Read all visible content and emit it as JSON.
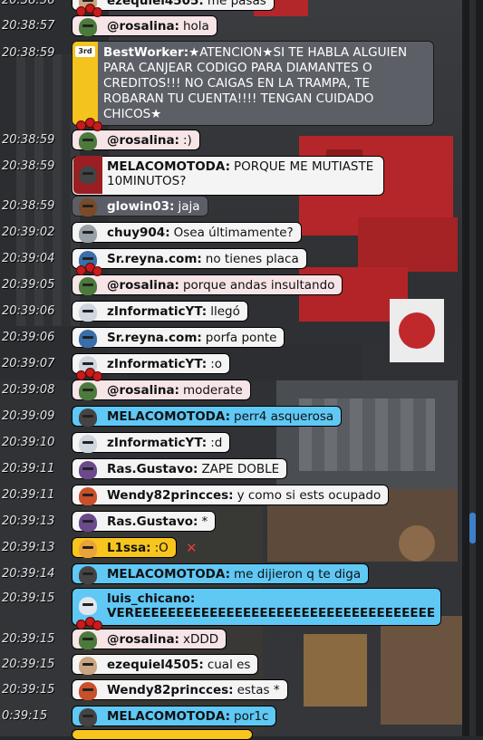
{
  "colors": {
    "bubble_default": "#f4f4f4",
    "bubble_blue": "#5fc8f5",
    "bubble_pink": "#f6e4e6",
    "announce_bg": "#5c5f66",
    "announce_strip": "#f4c31d",
    "scrollbar_thumb": "#3f7fc9"
  },
  "chat": [
    {
      "time": "20:38:56",
      "user": "ezequiel4505:",
      "text": "me pasas",
      "style": "default",
      "avatar": "red-cap-avatar"
    },
    {
      "time": "20:38:57",
      "user": "@rosalina:",
      "text": "hola",
      "style": "pink",
      "avatar": "red-flower-avatar"
    },
    {
      "time": "20:38:59",
      "user": "@rosalina:",
      "text": ":)",
      "style": "pink",
      "avatar": "red-flower-avatar"
    },
    {
      "time": "20:38:59",
      "user": "MELACOMOTODA:",
      "text": "PORQUE ME MUTIASTE",
      "text2": "10MINUTOS?",
      "style": "tall",
      "avatar": "dark-helmet-avatar"
    },
    {
      "time": "20:38:59",
      "user": "glowin03:",
      "text": "jaja",
      "style": "gray",
      "avatar": "brown-hair-avatar"
    },
    {
      "time": "20:39:02",
      "user": "chuy904:",
      "text": "Osea últimamente?",
      "style": "default",
      "avatar": "gray-hat-avatar"
    },
    {
      "time": "20:39:04",
      "user": "Sr.reyna.com:",
      "text": "no tienes placa",
      "style": "default",
      "avatar": "blue-cap-avatar"
    },
    {
      "time": "20:39:05",
      "user": "@rosalina:",
      "text": "porque andas insultando",
      "style": "pink",
      "avatar": "red-flower-avatar"
    },
    {
      "time": "20:39:06",
      "user": "zInformaticYT:",
      "text": "llegó",
      "style": "default",
      "avatar": "white-hair-avatar"
    },
    {
      "time": "20:39:06",
      "user": "Sr.reyna.com:",
      "text": "porfa ponte",
      "style": "default",
      "avatar": "blue-cap-avatar"
    },
    {
      "time": "20:39:07",
      "user": "zInformaticYT:",
      "text": ":o",
      "style": "default",
      "avatar": "white-hair-avatar"
    },
    {
      "time": "20:39:08",
      "user": "@rosalina:",
      "text": "moderate",
      "style": "pink",
      "avatar": "red-flower-avatar"
    },
    {
      "time": "20:39:09",
      "user": "MELACOMOTODA:",
      "text": "perr4 asquerosa",
      "style": "blue",
      "avatar": "dark-helmet-avatar"
    },
    {
      "time": "20:39:10",
      "user": "zInformaticYT:",
      "text": ":d",
      "style": "default",
      "avatar": "white-hair-avatar"
    },
    {
      "time": "20:39:11",
      "user": "Ras.Gustavo:",
      "text": "ZAPE DOBLE",
      "style": "default",
      "avatar": "purple-hat-avatar"
    },
    {
      "time": "20:39:11",
      "user": "Wendy82princces:",
      "text": "y como si ests ocupado",
      "style": "default",
      "avatar": "red-hair-avatar"
    },
    {
      "time": "20:39:13",
      "user": "Ras.Gustavo:",
      "text": "*",
      "style": "default",
      "avatar": "purple-hat-avatar"
    },
    {
      "time": "20:39:13",
      "user": "L1ssa:",
      "text": ":O",
      "style": "default",
      "avatar": "yellow-avatar"
    },
    {
      "time": "20:39:14",
      "user": "MELACOMOTODA:",
      "text": "me dijieron q te diga",
      "style": "blue",
      "avatar": "dark-helmet-avatar"
    },
    {
      "time": "20:39:15",
      "user": "luis_chicano:",
      "text": "VEREEEEEEEEEEEEEEEEEEEEEEEEEEEEEEEEEEEE",
      "style": "blue-tall",
      "avatar": "white-spiky-avatar"
    },
    {
      "time": "20:39:15",
      "user": "@rosalina:",
      "text": "xDDD",
      "style": "pink",
      "avatar": "red-flower-avatar"
    },
    {
      "time": "20:39:15",
      "user": "ezequiel4505:",
      "text": "cual es",
      "style": "default",
      "avatar": "red-cap-avatar"
    },
    {
      "time": "20:39:15",
      "user": "Wendy82princces:",
      "text": "estas *",
      "style": "default",
      "avatar": "red-hair-avatar"
    },
    {
      "time": "20:39:15",
      "user": "MELACOMOTODA:",
      "text": "por1c",
      "style": "blue",
      "avatar": "dark-helmet-avatar"
    }
  ],
  "announcement": {
    "time": "20:38:59",
    "badge": "3rd",
    "user": "BestWorker:",
    "text": "★ATENCION★SI TE HABLA ALGUIEN PARA CANJEAR CODIGO PARA DIAMANTES O CREDITOS!!! NO CAIGAS EN LA TRAMPA, TE ROBARAN TU CUENTA!!!! TENGAN CUIDADO CHICOS★",
    "icon": "worker-badge-icon"
  },
  "last_time_partial": "0:39:15",
  "close_symbol": "✕"
}
